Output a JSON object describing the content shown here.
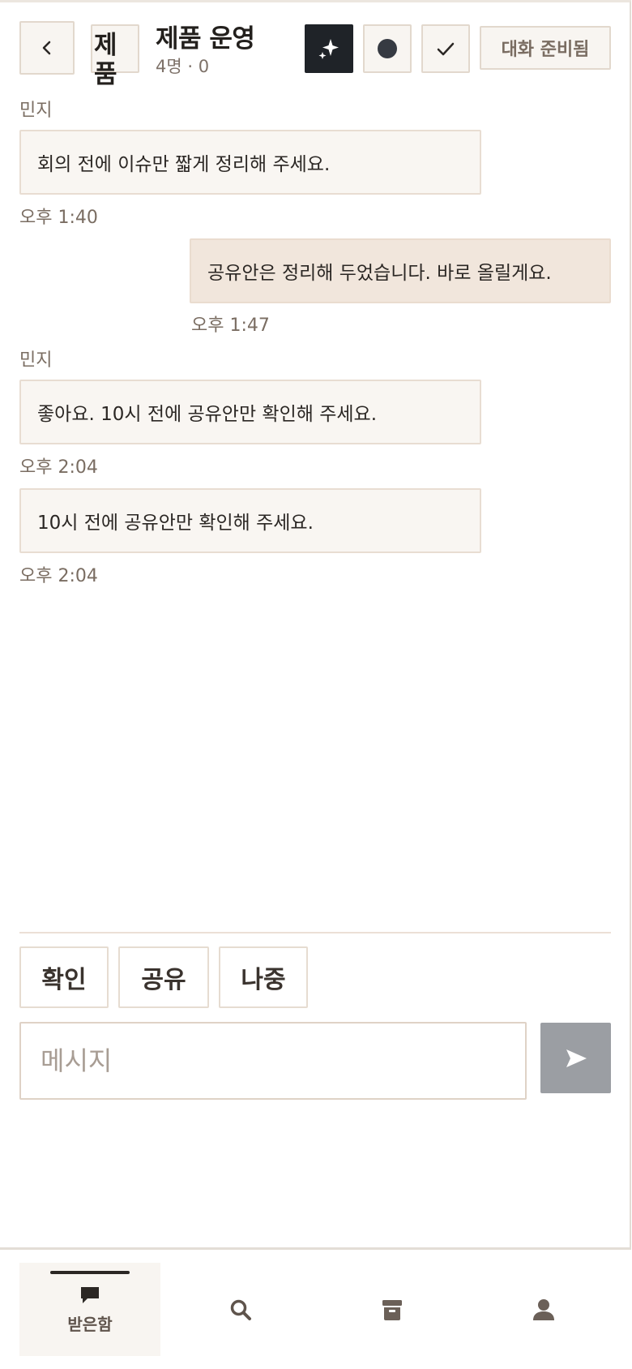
{
  "header": {
    "avatar_text": "제품",
    "title": "제품 운영",
    "subtitle": "4명 · 0",
    "ready_label": "대화 준비됨"
  },
  "messages": [
    {
      "sender": "민지",
      "text": "회의 전에 이슈만 짧게 정리해 주세요.",
      "time": "오후 1:40",
      "mine": false
    },
    {
      "sender": "",
      "text": "공유안은 정리해 두었습니다. 바로 올릴게요.",
      "time": "오후 1:47",
      "mine": true
    },
    {
      "sender": "민지",
      "text": "좋아요. 10시 전에 공유안만 확인해 주세요.",
      "time": "오후 2:04",
      "mine": false
    },
    {
      "sender": "",
      "text": "10시 전에 공유안만 확인해 주세요.",
      "time": "오후 2:04",
      "mine": false
    }
  ],
  "quick_replies": [
    "확인",
    "공유",
    "나중"
  ],
  "composer": {
    "placeholder": "메시지",
    "value": ""
  },
  "nav": [
    {
      "label": "받은함",
      "icon": "chat-bubble-icon",
      "active": true
    },
    {
      "label": "",
      "icon": "search-icon",
      "active": false
    },
    {
      "label": "",
      "icon": "archive-icon",
      "active": false
    },
    {
      "label": "",
      "icon": "profile-icon",
      "active": false
    }
  ],
  "colors": {
    "accent_dark": "#1f2328",
    "bubble_other": "#f9f6f2",
    "bubble_mine": "#f1e6dc",
    "send_disabled": "#9b9ea3"
  }
}
